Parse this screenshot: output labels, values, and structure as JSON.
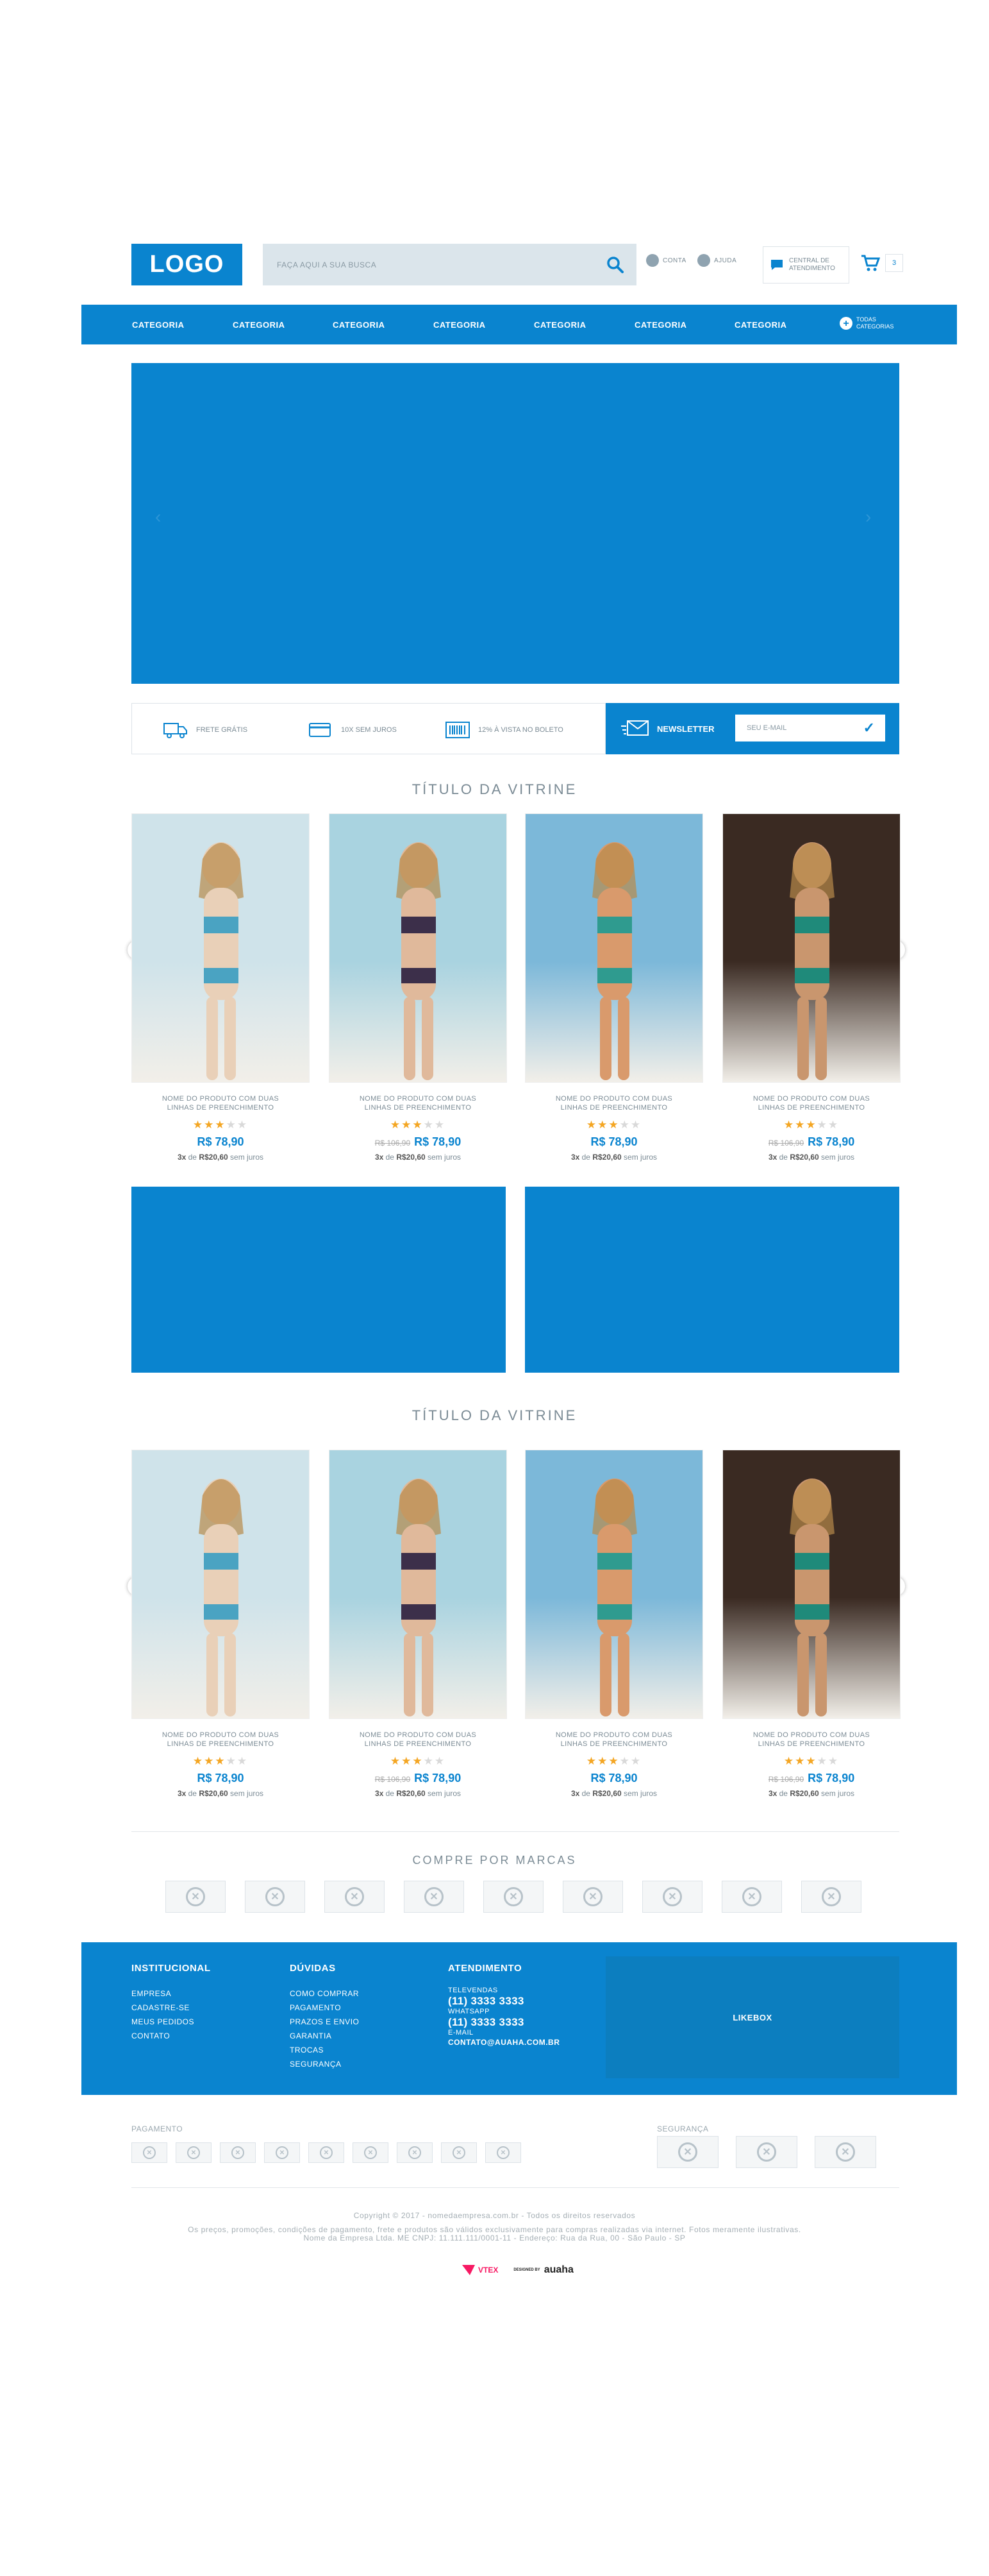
{
  "header": {
    "logo": "LOGO",
    "search_placeholder": "FAÇA AQUI A SUA BUSCA",
    "account": "CONTA",
    "help": "AJUDA",
    "service_line1": "CENTRAL DE",
    "service_line2": "ATENDIMENTO",
    "cart_count": "3"
  },
  "nav": {
    "categories": [
      "CATEGORIA",
      "CATEGORIA",
      "CATEGORIA",
      "CATEGORIA",
      "CATEGORIA",
      "CATEGORIA",
      "CATEGORIA"
    ],
    "all_line1": "TODAS",
    "all_line2": "CATEGORIAS"
  },
  "benefits": [
    "FRETE GRÁTIS",
    "10X SEM JUROS",
    "12% À VISTA NO BOLETO"
  ],
  "newsletter": {
    "label": "NEWSLETTER",
    "placeholder": "SEU E-MAIL"
  },
  "showcases": [
    {
      "title": "TÍTULO DA VITRINE",
      "products": [
        {
          "name": "NOME DO PRODUTO COM DUAS LINHAS DE PREENCHIMENTO",
          "rating": 3,
          "old_price": "",
          "price": "R$ 78,90",
          "installments": "3x",
          "installment_value": "R$20,60",
          "installment_suffix": "sem juros"
        },
        {
          "name": "NOME DO PRODUTO COM DUAS LINHAS DE PREENCHIMENTO",
          "rating": 3,
          "old_price": "R$ 106,90",
          "price": "R$ 78,90",
          "installments": "3x",
          "installment_value": "R$20,60",
          "installment_suffix": "sem juros"
        },
        {
          "name": "NOME DO PRODUTO COM DUAS LINHAS DE PREENCHIMENTO",
          "rating": 3,
          "old_price": "",
          "price": "R$ 78,90",
          "installments": "3x",
          "installment_value": "R$20,60",
          "installment_suffix": "sem juros"
        },
        {
          "name": "NOME DO PRODUTO COM DUAS LINHAS DE PREENCHIMENTO",
          "rating": 3,
          "old_price": "R$ 106,90",
          "price": "R$ 78,90",
          "installments": "3x",
          "installment_value": "R$20,60",
          "installment_suffix": "sem juros"
        }
      ]
    },
    {
      "title": "TÍTULO DA VITRINE",
      "products": [
        {
          "name": "NOME DO PRODUTO COM DUAS LINHAS DE PREENCHIMENTO",
          "rating": 3,
          "old_price": "",
          "price": "R$ 78,90",
          "installments": "3x",
          "installment_value": "R$20,60",
          "installment_suffix": "sem juros"
        },
        {
          "name": "NOME DO PRODUTO COM DUAS LINHAS DE PREENCHIMENTO",
          "rating": 3,
          "old_price": "R$ 106,90",
          "price": "R$ 78,90",
          "installments": "3x",
          "installment_value": "R$20,60",
          "installment_suffix": "sem juros"
        },
        {
          "name": "NOME DO PRODUTO COM DUAS LINHAS DE PREENCHIMENTO",
          "rating": 3,
          "old_price": "",
          "price": "R$ 78,90",
          "installments": "3x",
          "installment_value": "R$20,60",
          "installment_suffix": "sem juros"
        },
        {
          "name": "NOME DO PRODUTO COM DUAS LINHAS DE PREENCHIMENTO",
          "rating": 3,
          "old_price": "R$ 106,90",
          "price": "R$ 78,90",
          "installments": "3x",
          "installment_value": "R$20,60",
          "installment_suffix": "sem juros"
        }
      ]
    }
  ],
  "brands_title": "COMPRE POR MARCAS",
  "footer": {
    "institucional": {
      "title": "INSTITUCIONAL",
      "links": [
        "EMPRESA",
        "CADASTRE-SE",
        "MEUS PEDIDOS",
        "CONTATO"
      ]
    },
    "duvidas": {
      "title": "DÚVIDAS",
      "links": [
        "COMO COMPRAR",
        "PAGAMENTO",
        "PRAZOS E ENVIO",
        "GARANTIA",
        "TROCAS",
        "SEGURANÇA"
      ]
    },
    "atendimento": {
      "title": "ATENDIMENTO",
      "tele_label": "TELEVENDAS",
      "tele": "(11) 3333 3333",
      "whats_label": "WHATSAPP",
      "whats": "(11) 3333 3333",
      "email_label": "E-MAIL",
      "email": "CONTATO@AUAHA.COM.BR"
    },
    "likebox": "LIKEBOX"
  },
  "payment_label": "PAGAMENTO",
  "security_label": "SEGURANÇA",
  "copyright": "Copyright © 2017 - nomedaempresa.com.br - Todos os direitos reservados",
  "disclaimer": "Os preços, promoções, condições de pagamento, frete e produtos são válidos exclusivamente para compras realizadas via internet. Fotos meramente ilustrativas.",
  "address": "Nome da Empresa Ltda. ME CNPJ: 11.111.111/0001-11 - Endereço: Rua da Rua, 00 - São Paulo - SP",
  "credits": {
    "vtex": "VTEX",
    "designed_by": "DESIGNED BY",
    "agency": "auaha"
  },
  "colors": {
    "brand": "#0a84cf",
    "star": "#f4a623"
  }
}
